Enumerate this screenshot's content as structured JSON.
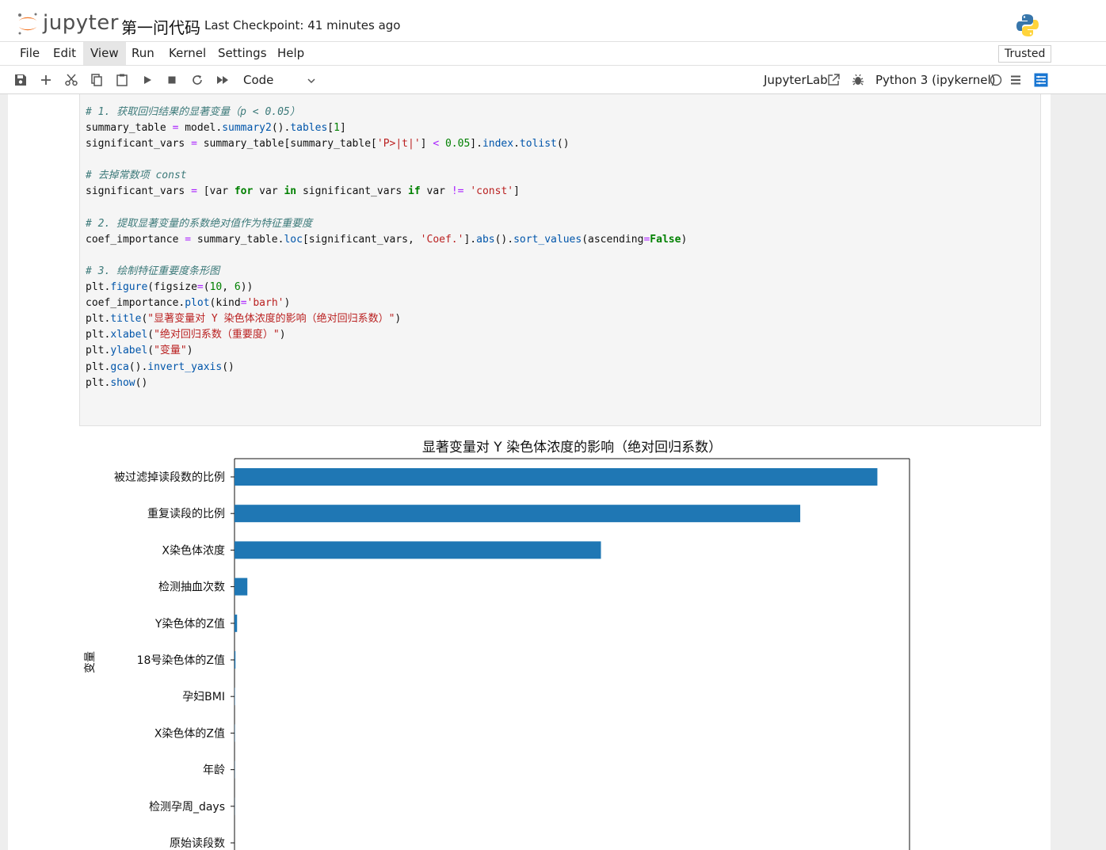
{
  "header": {
    "brand": "jupyter",
    "notebook_title": "第一问代码",
    "checkpoint": "Last Checkpoint: 41 minutes ago"
  },
  "menu": {
    "items": [
      "File",
      "Edit",
      "View",
      "Run",
      "Kernel",
      "Settings",
      "Help"
    ],
    "active": "View",
    "trusted": "Trusted"
  },
  "toolbar": {
    "icons": [
      "save-icon",
      "add-icon",
      "cut-icon",
      "copy-icon",
      "paste-icon",
      "run-icon",
      "stop-icon",
      "restart-icon",
      "fast-forward-icon"
    ],
    "cell_type": "Code",
    "jupyterlab_link": "JupyterLab",
    "kernel_name": "Python 3 (ipykernel)",
    "accent": "#1976d2"
  },
  "code_lines": [
    [
      {
        "t": "# 1. 获取回归结果的显著变量（p < 0.05）",
        "c": "cm"
      }
    ],
    [
      {
        "t": "summary_table ",
        "c": "ln"
      },
      {
        "t": "=",
        "c": "op"
      },
      {
        "t": " model.",
        "c": "ln"
      },
      {
        "t": "summary2",
        "c": "fn"
      },
      {
        "t": "().",
        "c": "ln"
      },
      {
        "t": "tables",
        "c": "fn"
      },
      {
        "t": "[",
        "c": "ln"
      },
      {
        "t": "1",
        "c": "nm"
      },
      {
        "t": "]",
        "c": "ln"
      }
    ],
    [
      {
        "t": "significant_vars ",
        "c": "ln"
      },
      {
        "t": "=",
        "c": "op"
      },
      {
        "t": " summary_table[summary_table[",
        "c": "ln"
      },
      {
        "t": "'P>|t|'",
        "c": "st"
      },
      {
        "t": "] ",
        "c": "ln"
      },
      {
        "t": "<",
        "c": "op"
      },
      {
        "t": " ",
        "c": "ln"
      },
      {
        "t": "0.05",
        "c": "nm"
      },
      {
        "t": "].",
        "c": "ln"
      },
      {
        "t": "index",
        "c": "fn"
      },
      {
        "t": ".",
        "c": "ln"
      },
      {
        "t": "tolist",
        "c": "fn"
      },
      {
        "t": "()",
        "c": "ln"
      }
    ],
    [
      {
        "t": "",
        "c": "ln"
      }
    ],
    [
      {
        "t": "# 去掉常数项 const",
        "c": "cm"
      }
    ],
    [
      {
        "t": "significant_vars ",
        "c": "ln"
      },
      {
        "t": "=",
        "c": "op"
      },
      {
        "t": " [var ",
        "c": "ln"
      },
      {
        "t": "for",
        "c": "kw"
      },
      {
        "t": " var ",
        "c": "ln"
      },
      {
        "t": "in",
        "c": "kw"
      },
      {
        "t": " significant_vars ",
        "c": "ln"
      },
      {
        "t": "if",
        "c": "kw"
      },
      {
        "t": " var ",
        "c": "ln"
      },
      {
        "t": "!=",
        "c": "op"
      },
      {
        "t": " ",
        "c": "ln"
      },
      {
        "t": "'const'",
        "c": "st"
      },
      {
        "t": "]",
        "c": "ln"
      }
    ],
    [
      {
        "t": "",
        "c": "ln"
      }
    ],
    [
      {
        "t": "# 2. 提取显著变量的系数绝对值作为特征重要度",
        "c": "cm"
      }
    ],
    [
      {
        "t": "coef_importance ",
        "c": "ln"
      },
      {
        "t": "=",
        "c": "op"
      },
      {
        "t": " summary_table.",
        "c": "ln"
      },
      {
        "t": "loc",
        "c": "fn"
      },
      {
        "t": "[significant_vars, ",
        "c": "ln"
      },
      {
        "t": "'Coef.'",
        "c": "st"
      },
      {
        "t": "].",
        "c": "ln"
      },
      {
        "t": "abs",
        "c": "fn"
      },
      {
        "t": "().",
        "c": "ln"
      },
      {
        "t": "sort_values",
        "c": "fn"
      },
      {
        "t": "(ascending",
        "c": "ln"
      },
      {
        "t": "=",
        "c": "op"
      },
      {
        "t": "False",
        "c": "kw"
      },
      {
        "t": ")",
        "c": "ln"
      }
    ],
    [
      {
        "t": "",
        "c": "ln"
      }
    ],
    [
      {
        "t": "# 3. 绘制特征重要度条形图",
        "c": "cm"
      }
    ],
    [
      {
        "t": "plt.",
        "c": "ln"
      },
      {
        "t": "figure",
        "c": "fn"
      },
      {
        "t": "(figsize",
        "c": "ln"
      },
      {
        "t": "=",
        "c": "op"
      },
      {
        "t": "(",
        "c": "ln"
      },
      {
        "t": "10",
        "c": "nm"
      },
      {
        "t": ", ",
        "c": "ln"
      },
      {
        "t": "6",
        "c": "nm"
      },
      {
        "t": "))",
        "c": "ln"
      }
    ],
    [
      {
        "t": "coef_importance.",
        "c": "ln"
      },
      {
        "t": "plot",
        "c": "fn"
      },
      {
        "t": "(kind",
        "c": "ln"
      },
      {
        "t": "=",
        "c": "op"
      },
      {
        "t": "'barh'",
        "c": "st"
      },
      {
        "t": ")",
        "c": "ln"
      }
    ],
    [
      {
        "t": "plt.",
        "c": "ln"
      },
      {
        "t": "title",
        "c": "fn"
      },
      {
        "t": "(",
        "c": "ln"
      },
      {
        "t": "\"显著变量对 Y 染色体浓度的影响（绝对回归系数）\"",
        "c": "st"
      },
      {
        "t": ")",
        "c": "ln"
      }
    ],
    [
      {
        "t": "plt.",
        "c": "ln"
      },
      {
        "t": "xlabel",
        "c": "fn"
      },
      {
        "t": "(",
        "c": "ln"
      },
      {
        "t": "\"绝对回归系数（重要度）\"",
        "c": "st"
      },
      {
        "t": ")",
        "c": "ln"
      }
    ],
    [
      {
        "t": "plt.",
        "c": "ln"
      },
      {
        "t": "ylabel",
        "c": "fn"
      },
      {
        "t": "(",
        "c": "ln"
      },
      {
        "t": "\"变量\"",
        "c": "st"
      },
      {
        "t": ")",
        "c": "ln"
      }
    ],
    [
      {
        "t": "plt.",
        "c": "ln"
      },
      {
        "t": "gca",
        "c": "fn"
      },
      {
        "t": "().",
        "c": "ln"
      },
      {
        "t": "invert_yaxis",
        "c": "fn"
      },
      {
        "t": "()",
        "c": "ln"
      }
    ],
    [
      {
        "t": "plt.",
        "c": "ln"
      },
      {
        "t": "show",
        "c": "fn"
      },
      {
        "t": "()",
        "c": "ln"
      }
    ]
  ],
  "chart_data": {
    "type": "bar",
    "orientation": "horizontal",
    "title": "显著变量对 Y 染色体浓度的影响（绝对回归系数）",
    "ylabel": "变量",
    "categories": [
      "被过滤掉读段数的比例",
      "重复读段的比例",
      "X染色体浓度",
      "检测抽血次数",
      "Y染色体的Z值",
      "18号染色体的Z值",
      "孕妇BMI",
      "X染色体的Z值",
      "年龄",
      "检测孕周_days",
      "原始读段数"
    ],
    "values": [
      1.0,
      0.88,
      0.57,
      0.02,
      0.004,
      0.0015,
      0.0005,
      0.0004,
      0.0003,
      0.0002,
      1e-05
    ],
    "xlim": [
      0,
      1.05
    ],
    "bar_color": "#1f77b4",
    "grid": false
  }
}
